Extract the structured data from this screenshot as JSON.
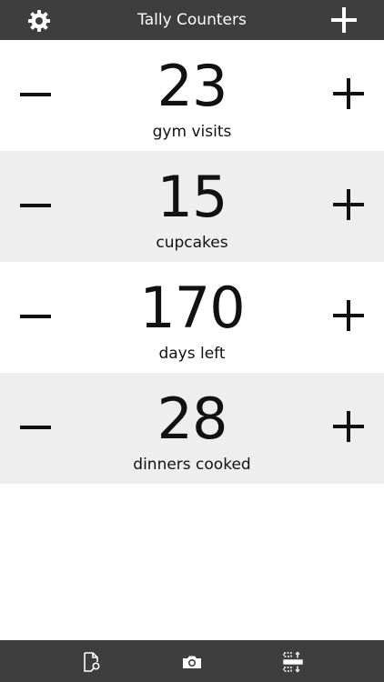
{
  "header": {
    "title": "Tally Counters",
    "settings_icon": "gear-icon",
    "add_icon": "plus-icon"
  },
  "counters": [
    {
      "value": "23",
      "label": "gym visits"
    },
    {
      "value": "15",
      "label": "cupcakes"
    },
    {
      "value": "170",
      "label": "days left"
    },
    {
      "value": "28",
      "label": "dinners cooked"
    }
  ],
  "toolbar": {
    "items": [
      {
        "icon": "document-search-icon"
      },
      {
        "icon": "camera-icon"
      },
      {
        "icon": "reorder-icon"
      }
    ]
  },
  "colors": {
    "bar_background": "#3e3e3e",
    "row_alt_background": "#eeeeee",
    "text": "#111111"
  }
}
